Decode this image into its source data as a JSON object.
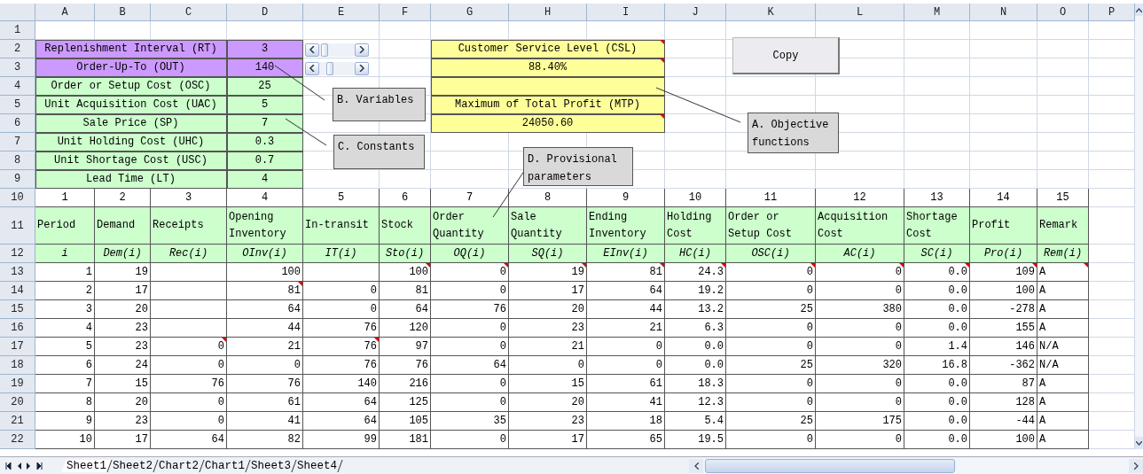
{
  "columns": [
    "A",
    "B",
    "C",
    "D",
    "E",
    "F",
    "G",
    "H",
    "I",
    "J",
    "K",
    "L",
    "M",
    "N",
    "O",
    "P"
  ],
  "row_numbers": [
    "1",
    "2",
    "3",
    "4",
    "5",
    "6",
    "7",
    "8",
    "9",
    "10",
    "11",
    "12",
    "13",
    "14",
    "15",
    "16",
    "17",
    "18",
    "19",
    "20",
    "21",
    "22"
  ],
  "parameters": [
    {
      "label": "Replenishment Interval (RT)",
      "value": "3",
      "kind": "variable"
    },
    {
      "label": "Order-Up-To (OUT)",
      "value": "140",
      "kind": "variable"
    },
    {
      "label": "Order or Setup Cost (OSC)",
      "value": "25",
      "kind": "constant"
    },
    {
      "label": "Unit Acquisition Cost (UAC)",
      "value": "5",
      "kind": "constant"
    },
    {
      "label": "Sale Price (SP)",
      "value": "7",
      "kind": "constant"
    },
    {
      "label": "Unit Holding Cost (UHC)",
      "value": "0.3",
      "kind": "constant"
    },
    {
      "label": "Unit Shortage Cost (USC)",
      "value": "0.7",
      "kind": "constant"
    },
    {
      "label": "Lead Time (LT)",
      "value": "4",
      "kind": "constant"
    }
  ],
  "objectives": [
    {
      "text": "Customer Service Level (CSL)",
      "note": true
    },
    {
      "text": "88.40%",
      "note": true
    },
    {
      "note": false
    },
    {
      "text": "Maximum of Total Profit (MTP)",
      "note": false
    },
    {
      "text": "24050.60",
      "note": true
    }
  ],
  "copy_button": "Copy",
  "callouts": [
    "B. Variables",
    "C. Constants",
    "D. Provisional parameters",
    "A. Objective functions"
  ],
  "index_row": [
    "1",
    "2",
    "3",
    "4",
    "5",
    "6",
    "7",
    "8",
    "9",
    "10",
    "11",
    "12",
    "13",
    "14",
    "15"
  ],
  "header_row": [
    "Period",
    "Demand",
    "Receipts",
    "Opening Inventory",
    "In-transit",
    "Stock",
    "Order Quantity",
    "Sale Quantity",
    "Ending Inventory",
    "Holding Cost",
    "Order or Setup Cost",
    "Acquisition Cost",
    "Shortage Cost",
    "Profit",
    "Remark"
  ],
  "symbol_row": [
    "i",
    "Dem(i)",
    "Rec(i)",
    "OInv(i)",
    "IT(i)",
    "Sto(i)",
    "OQ(i)",
    "SQ(i)",
    "EInv(i)",
    "HC(i)",
    "OSC(i)",
    "AC(i)",
    "SC(i)",
    "Pro(i)",
    "Rem(i)"
  ],
  "rows": [
    {
      "cells": [
        "1",
        "19",
        null,
        "100",
        null,
        "100",
        "0",
        "19",
        "81",
        "24.3",
        "0",
        "0",
        "0.0",
        "109",
        "A"
      ],
      "notes": [
        false,
        false,
        false,
        false,
        false,
        true,
        true,
        true,
        true,
        true,
        true,
        true,
        true,
        true,
        true
      ]
    },
    {
      "cells": [
        "2",
        "17",
        null,
        "81",
        "0",
        "81",
        "0",
        "17",
        "64",
        "19.2",
        "0",
        "0",
        "0.0",
        "100",
        "A"
      ],
      "notes": [
        false,
        false,
        false,
        true,
        false,
        false,
        false,
        false,
        false,
        false,
        false,
        false,
        false,
        false,
        false
      ]
    },
    {
      "cells": [
        "3",
        "20",
        null,
        "64",
        "0",
        "64",
        "76",
        "20",
        "44",
        "13.2",
        "25",
        "380",
        "0.0",
        "-278",
        "A"
      ],
      "notes": [
        false,
        false,
        false,
        false,
        false,
        false,
        false,
        false,
        false,
        false,
        false,
        false,
        false,
        false,
        false
      ]
    },
    {
      "cells": [
        "4",
        "23",
        null,
        "44",
        "76",
        "120",
        "0",
        "23",
        "21",
        "6.3",
        "0",
        "0",
        "0.0",
        "155",
        "A"
      ],
      "notes": [
        false,
        false,
        false,
        false,
        false,
        false,
        false,
        false,
        false,
        false,
        false,
        false,
        false,
        false,
        false
      ]
    },
    {
      "cells": [
        "5",
        "23",
        "0",
        "21",
        "76",
        "97",
        "0",
        "21",
        "0",
        "0.0",
        "0",
        "0",
        "1.4",
        "146",
        "N/A"
      ],
      "notes": [
        false,
        false,
        true,
        false,
        true,
        false,
        false,
        false,
        false,
        false,
        false,
        false,
        false,
        false,
        false
      ]
    },
    {
      "cells": [
        "6",
        "24",
        "0",
        "0",
        "76",
        "76",
        "64",
        "0",
        "0",
        "0.0",
        "25",
        "320",
        "16.8",
        "-362",
        "N/A"
      ],
      "notes": [
        false,
        false,
        false,
        false,
        false,
        false,
        false,
        false,
        false,
        false,
        false,
        false,
        false,
        false,
        false
      ]
    },
    {
      "cells": [
        "7",
        "15",
        "76",
        "76",
        "140",
        "216",
        "0",
        "15",
        "61",
        "18.3",
        "0",
        "0",
        "0.0",
        "87",
        "A"
      ],
      "notes": [
        false,
        false,
        false,
        false,
        false,
        false,
        false,
        false,
        false,
        false,
        false,
        false,
        false,
        false,
        false
      ]
    },
    {
      "cells": [
        "8",
        "20",
        "0",
        "61",
        "64",
        "125",
        "0",
        "20",
        "41",
        "12.3",
        "0",
        "0",
        "0.0",
        "128",
        "A"
      ],
      "notes": [
        false,
        false,
        false,
        false,
        false,
        false,
        false,
        false,
        false,
        false,
        false,
        false,
        false,
        false,
        false
      ]
    },
    {
      "cells": [
        "9",
        "23",
        "0",
        "41",
        "64",
        "105",
        "35",
        "23",
        "18",
        "5.4",
        "25",
        "175",
        "0.0",
        "-44",
        "A"
      ],
      "notes": [
        false,
        false,
        false,
        false,
        false,
        false,
        false,
        false,
        false,
        false,
        false,
        false,
        false,
        false,
        false
      ]
    },
    {
      "cells": [
        "10",
        "17",
        "64",
        "82",
        "99",
        "181",
        "0",
        "17",
        "65",
        "19.5",
        "0",
        "0",
        "0.0",
        "100",
        "A"
      ],
      "notes": [
        false,
        false,
        false,
        false,
        false,
        false,
        false,
        false,
        false,
        false,
        false,
        false,
        false,
        false,
        false
      ]
    }
  ],
  "sheet_tabs": [
    {
      "label": "Sheet1",
      "selected": true
    },
    {
      "label": "Sheet2",
      "selected": false
    },
    {
      "label": "Chart2",
      "selected": false
    },
    {
      "label": "Chart1",
      "selected": false
    },
    {
      "label": "Sheet3",
      "selected": false
    },
    {
      "label": "Sheet4",
      "selected": false
    }
  ]
}
